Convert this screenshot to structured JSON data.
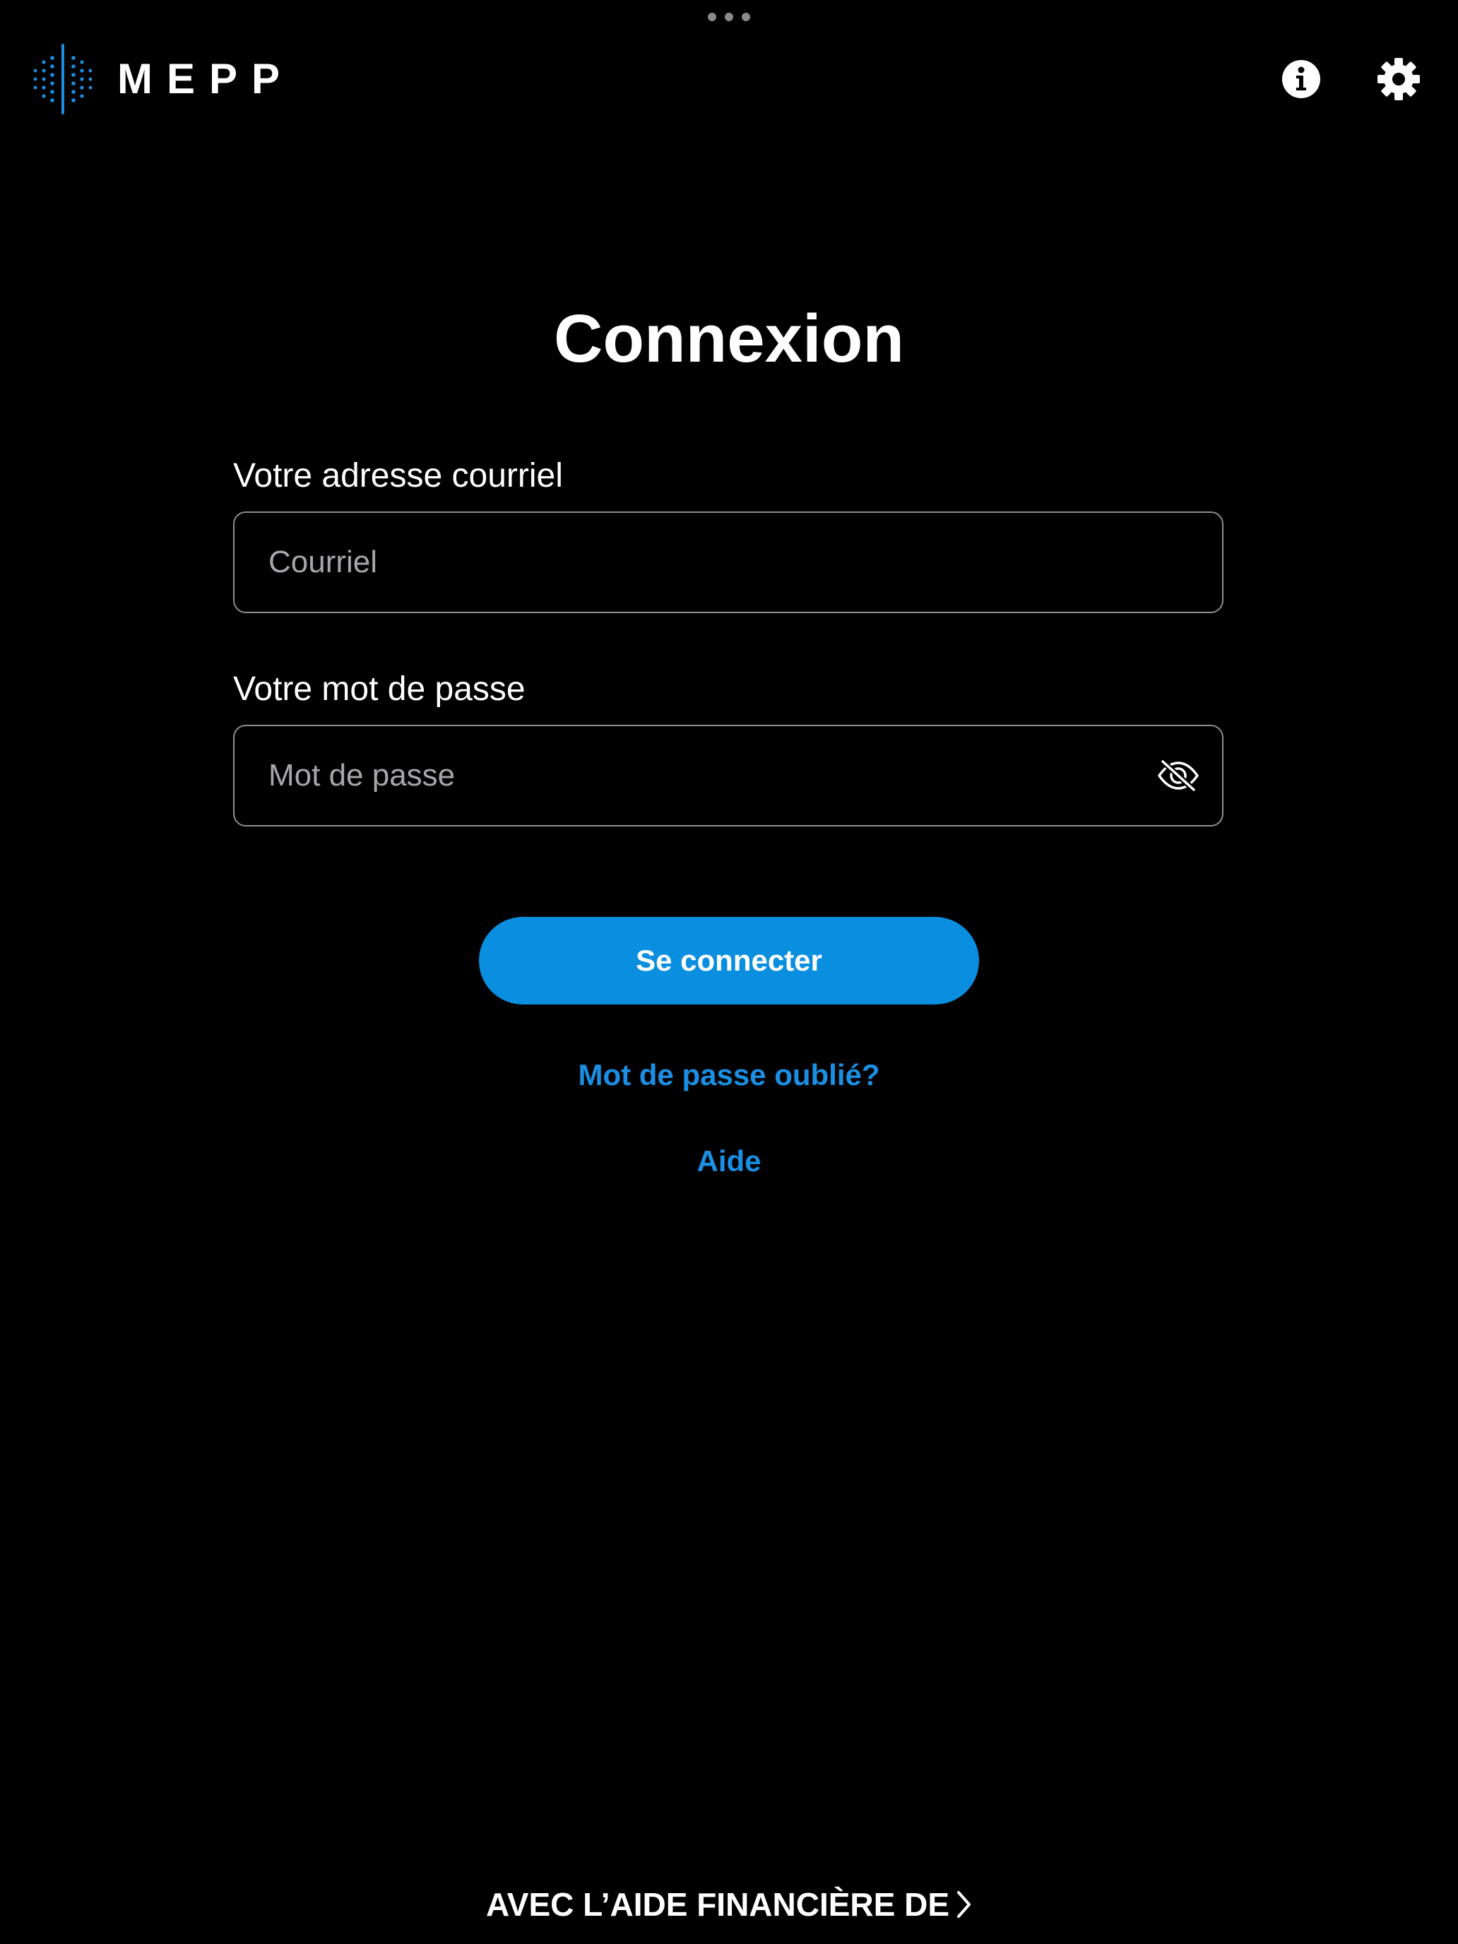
{
  "app": {
    "logo_text": "MEPP"
  },
  "colors": {
    "background": "#000000",
    "accent": "#0a8fe0",
    "link": "#1a8fe3",
    "input_border": "#8e8e93",
    "placeholder": "#a6a6ab",
    "text": "#ffffff"
  },
  "header": {
    "info_icon": "info-circle-icon",
    "settings_icon": "gear-icon"
  },
  "login": {
    "title": "Connexion",
    "email_label": "Votre adresse courriel",
    "email_placeholder": "Courriel",
    "email_value": "",
    "password_label": "Votre mot de passe",
    "password_placeholder": "Mot de passe",
    "password_value": "",
    "password_toggle_icon": "eye-slash-icon",
    "submit_label": "Se connecter",
    "forgot_label": "Mot de passe oublié?",
    "help_label": "Aide"
  },
  "footer": {
    "label": "AVEC L’AIDE FINANCIÈRE DE",
    "icon": "chevron-right-icon"
  }
}
